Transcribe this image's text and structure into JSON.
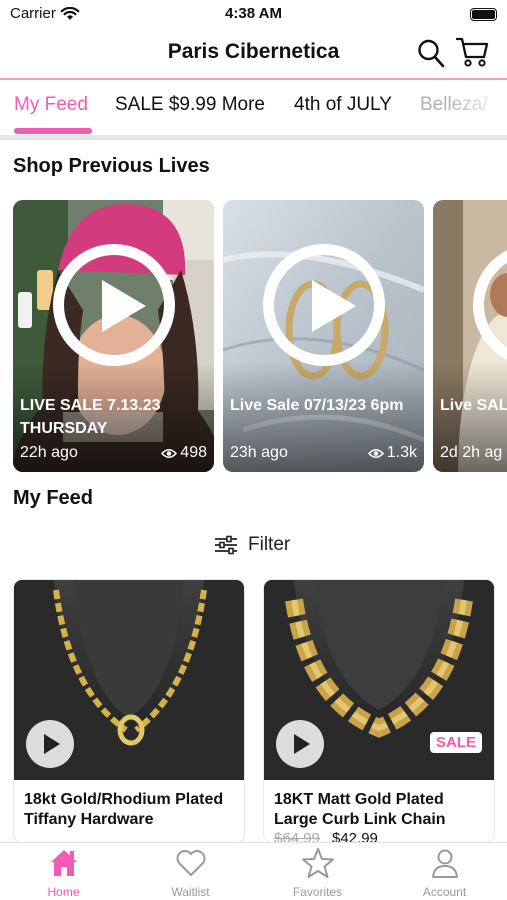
{
  "status_bar": {
    "carrier": "Carrier",
    "time": "4:38 AM"
  },
  "header": {
    "title": "Paris Cibernetica"
  },
  "tabs": [
    {
      "label": "My Feed",
      "active": true
    },
    {
      "label": "SALE $9.99 More"
    },
    {
      "label": "4th of JULY"
    },
    {
      "label": "Belleza/"
    }
  ],
  "sections": {
    "previous_lives": "Shop Previous Lives",
    "my_feed": "My Feed"
  },
  "lives": [
    {
      "title": "LIVE SALE 7.13.23 THURSDAY",
      "time": "22h ago",
      "views": "498"
    },
    {
      "title": "Live Sale 07/13/23 6pm",
      "time": "23h ago",
      "views": "1.3k"
    },
    {
      "title": "Live SAL",
      "time": "2d 2h ag",
      "views": ""
    }
  ],
  "filter": {
    "label": "Filter"
  },
  "products": [
    {
      "name": "18kt Gold/Rhodium Plated Tiffany Hardware",
      "sale": false
    },
    {
      "name": "18KT  Matt Gold Plated Large Curb Link Chain",
      "sale": true,
      "badge": "SALE",
      "price_old": "$64.99",
      "price_new": "$42.99"
    }
  ],
  "bottom_nav": [
    {
      "label": "Home",
      "icon": "home-icon",
      "active": true
    },
    {
      "label": "Waitlist",
      "icon": "heart-icon"
    },
    {
      "label": "Favorites",
      "icon": "star-icon"
    },
    {
      "label": "Account",
      "icon": "person-icon"
    }
  ],
  "colors": {
    "accent": "#f25bb4",
    "rule": "#f29ad0"
  }
}
